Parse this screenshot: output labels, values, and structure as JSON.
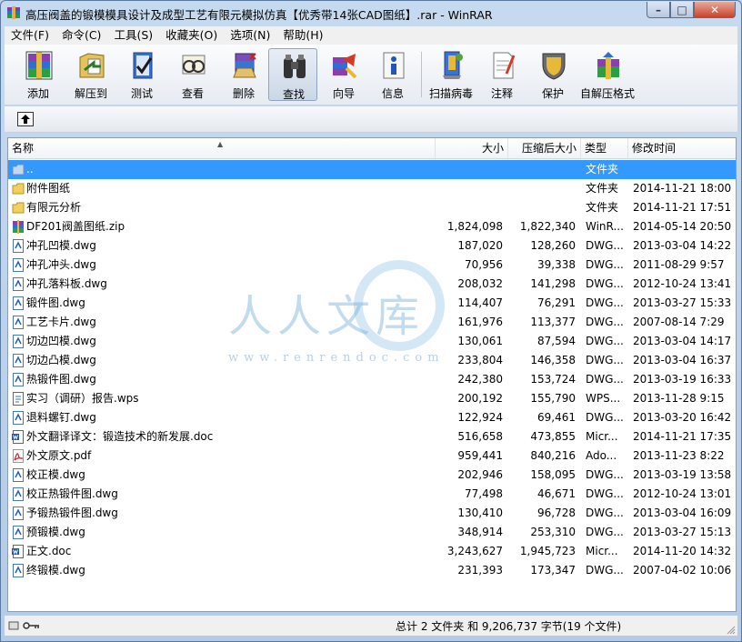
{
  "window": {
    "title": "高压阀盖的锻模模具设计及成型工艺有限元模拟仿真【优秀带14张CAD图纸】.rar - WinRAR",
    "min_glyph": "–",
    "max_glyph": "□",
    "close_glyph": "✕"
  },
  "menu": [
    "文件(F)",
    "命令(C)",
    "工具(S)",
    "收藏夹(O)",
    "选项(N)",
    "帮助(H)"
  ],
  "toolbar": [
    {
      "label": "添加",
      "icon": "add-archive-icon"
    },
    {
      "label": "解压到",
      "icon": "extract-to-icon"
    },
    {
      "label": "测试",
      "icon": "test-icon"
    },
    {
      "label": "查看",
      "icon": "view-icon"
    },
    {
      "label": "删除",
      "icon": "delete-icon"
    },
    {
      "label": "查找",
      "icon": "find-binoculars-icon"
    },
    {
      "label": "向导",
      "icon": "wizard-icon"
    },
    {
      "label": "信息",
      "icon": "info-icon"
    },
    {
      "label": "扫描病毒",
      "icon": "virus-scan-icon"
    },
    {
      "label": "注释",
      "icon": "comment-icon"
    },
    {
      "label": "保护",
      "icon": "protect-shield-icon"
    },
    {
      "label": "自解压格式",
      "icon": "sfx-icon"
    }
  ],
  "columns": {
    "name": "名称",
    "size": "大小",
    "packed": "压缩后大小",
    "type": "类型",
    "modified": "修改时间"
  },
  "files": [
    {
      "name": "..",
      "size": "",
      "packed": "",
      "type": "文件夹",
      "modified": "",
      "kind": "folder-up"
    },
    {
      "name": "附件图纸",
      "size": "",
      "packed": "",
      "type": "文件夹",
      "modified": "2014-11-21 18:00",
      "kind": "folder"
    },
    {
      "name": "有限元分析",
      "size": "",
      "packed": "",
      "type": "文件夹",
      "modified": "2014-11-21 17:51",
      "kind": "folder"
    },
    {
      "name": "DF201阀盖图纸.zip",
      "size": "1,824,098",
      "packed": "1,822,340",
      "type": "WinR...",
      "modified": "2014-05-14 20:50",
      "kind": "zip"
    },
    {
      "name": "冲孔凹模.dwg",
      "size": "187,020",
      "packed": "128,260",
      "type": "DWG...",
      "modified": "2013-03-04 14:22",
      "kind": "dwg"
    },
    {
      "name": "冲孔冲头.dwg",
      "size": "70,956",
      "packed": "39,338",
      "type": "DWG...",
      "modified": "2011-08-29 9:57",
      "kind": "dwg"
    },
    {
      "name": "冲孔落料板.dwg",
      "size": "208,032",
      "packed": "141,298",
      "type": "DWG...",
      "modified": "2012-10-24 13:41",
      "kind": "dwg"
    },
    {
      "name": "锻件图.dwg",
      "size": "114,407",
      "packed": "76,291",
      "type": "DWG...",
      "modified": "2013-03-27 15:33",
      "kind": "dwg"
    },
    {
      "name": "工艺卡片.dwg",
      "size": "161,976",
      "packed": "113,377",
      "type": "DWG...",
      "modified": "2007-08-14 7:29",
      "kind": "dwg"
    },
    {
      "name": "切边凹模.dwg",
      "size": "130,061",
      "packed": "87,594",
      "type": "DWG...",
      "modified": "2013-03-04 14:17",
      "kind": "dwg"
    },
    {
      "name": "切边凸模.dwg",
      "size": "233,804",
      "packed": "146,358",
      "type": "DWG...",
      "modified": "2013-03-04 16:37",
      "kind": "dwg"
    },
    {
      "name": "热锻件图.dwg",
      "size": "242,380",
      "packed": "153,724",
      "type": "DWG...",
      "modified": "2013-03-19 16:33",
      "kind": "dwg"
    },
    {
      "name": "实习（调研）报告.wps",
      "size": "200,192",
      "packed": "155,790",
      "type": "WPS...",
      "modified": "2013-11-28 9:15",
      "kind": "wps"
    },
    {
      "name": "退料螺钉.dwg",
      "size": "122,924",
      "packed": "69,461",
      "type": "DWG...",
      "modified": "2013-03-20 16:42",
      "kind": "dwg"
    },
    {
      "name": "外文翻译译文：锻造技术的新发展.doc",
      "size": "516,658",
      "packed": "473,855",
      "type": "Micr...",
      "modified": "2014-11-21 17:35",
      "kind": "doc"
    },
    {
      "name": "外文原文.pdf",
      "size": "959,441",
      "packed": "840,216",
      "type": "Ado...",
      "modified": "2013-11-23 8:22",
      "kind": "pdf"
    },
    {
      "name": "校正模.dwg",
      "size": "202,946",
      "packed": "158,095",
      "type": "DWG...",
      "modified": "2013-03-19 13:58",
      "kind": "dwg"
    },
    {
      "name": "校正热锻件图.dwg",
      "size": "77,498",
      "packed": "46,671",
      "type": "DWG...",
      "modified": "2012-10-24 13:01",
      "kind": "dwg"
    },
    {
      "name": "予锻热锻件图.dwg",
      "size": "130,410",
      "packed": "96,728",
      "type": "DWG...",
      "modified": "2013-03-04 16:09",
      "kind": "dwg"
    },
    {
      "name": "预锻模.dwg",
      "size": "348,914",
      "packed": "253,310",
      "type": "DWG...",
      "modified": "2013-03-27 15:13",
      "kind": "dwg"
    },
    {
      "name": "正文.doc",
      "size": "3,243,627",
      "packed": "1,945,723",
      "type": "Micr...",
      "modified": "2014-11-20 14:32",
      "kind": "doc"
    },
    {
      "name": "终锻模.dwg",
      "size": "231,393",
      "packed": "173,347",
      "type": "DWG...",
      "modified": "2007-04-02 10:06",
      "kind": "dwg"
    }
  ],
  "watermark": {
    "text": "人人文库",
    "url": "www.renrendoc.com"
  },
  "status": {
    "summary": "总计 2 文件夹 和 9,206,737 字节(19 个文件)"
  }
}
